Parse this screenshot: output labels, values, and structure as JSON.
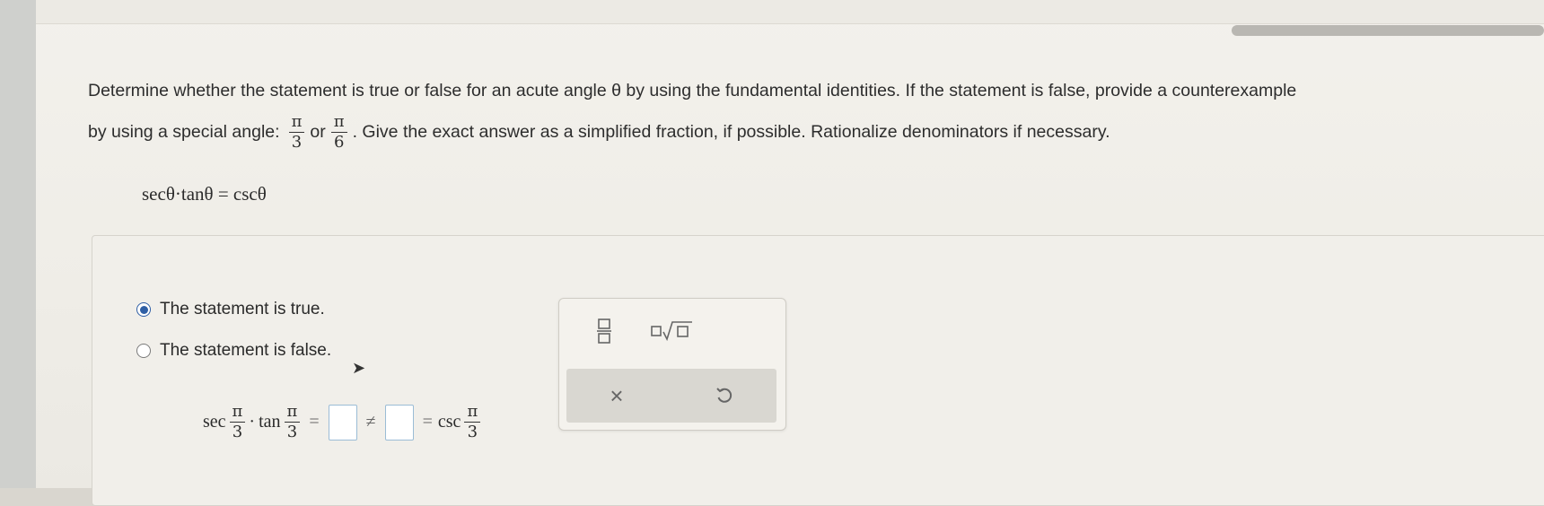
{
  "question": {
    "line1": "Determine whether the statement is true or false for an acute angle θ by using the fundamental identities. If the statement is false, provide a counterexample",
    "line2_prefix": "by using a special angle:",
    "angle1_num": "π",
    "angle1_den": "3",
    "or_text": "or",
    "angle2_num": "π",
    "angle2_den": "6",
    "line2_suffix": ". Give the exact answer as a simplified fraction, if possible. Rationalize denominators if necessary."
  },
  "statement": "secθ·tanθ = cscθ",
  "options": [
    {
      "label": "The statement is true.",
      "selected": true
    },
    {
      "label": "The statement is false.",
      "selected": false
    }
  ],
  "expression": {
    "sec": "sec",
    "tan": "tan",
    "csc": "csc",
    "pi": "π",
    "three": "3",
    "dot": "·",
    "eq": "=",
    "neq": "≠"
  },
  "palette": {
    "fraction_icon": "fraction-icon",
    "sqrt_icon": "sqrt-icon",
    "clear_label": "×",
    "undo_icon": "undo-icon"
  },
  "colors": {
    "radio_selected": "#2f5fa5",
    "input_border": "#9bbcd6"
  }
}
